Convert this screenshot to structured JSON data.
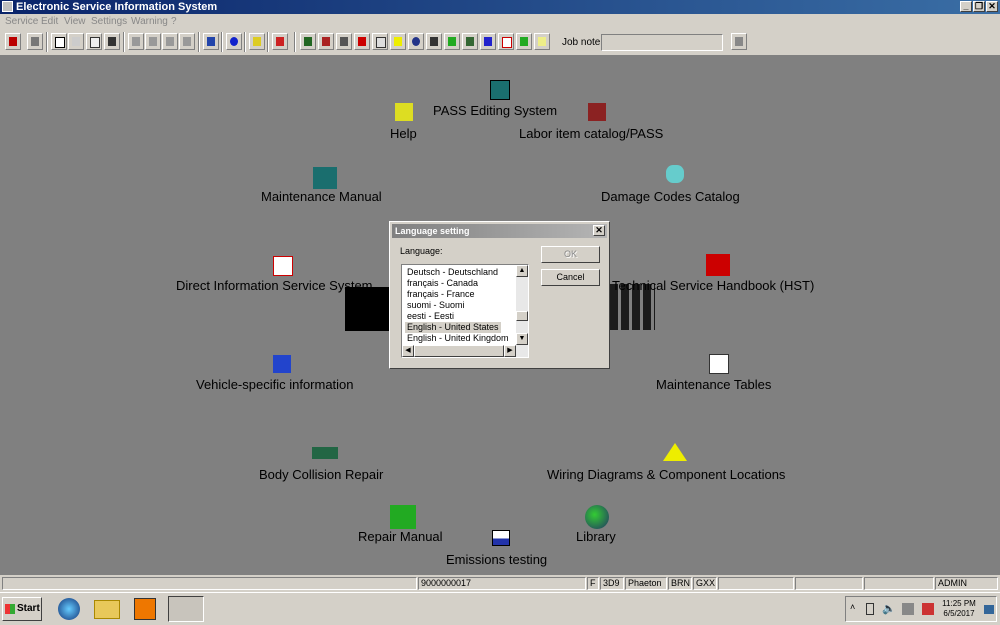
{
  "window": {
    "title": "Electronic Service Information System"
  },
  "menu": [
    "Service",
    "Edit",
    "View",
    "Settings",
    "Warning",
    "?"
  ],
  "toolbar": {
    "job_note_label": "Job note:",
    "job_note_value": ""
  },
  "main_items": [
    {
      "label": "PASS Editing System",
      "icon": "pass-icon"
    },
    {
      "label": "Help",
      "icon": "help-icon"
    },
    {
      "label": "Labor item catalog/PASS",
      "icon": "labor-catalog-icon"
    },
    {
      "label": "Maintenance Manual",
      "icon": "maintenance-manual-icon"
    },
    {
      "label": "Damage Codes Catalog",
      "icon": "damage-codes-icon"
    },
    {
      "label": "Direct Information Service System",
      "icon": "clipboard-check-icon"
    },
    {
      "label": "Technical Service Handbook (HST)",
      "icon": "handbook-icon"
    },
    {
      "label": "Vehicle-specific information",
      "icon": "vehicle-info-icon"
    },
    {
      "label": "Maintenance Tables",
      "icon": "table-icon"
    },
    {
      "label": "Body Collision Repair",
      "icon": "collision-icon"
    },
    {
      "label": "Wiring Diagrams & Component Locations",
      "icon": "warning-triangle-icon"
    },
    {
      "label": "Repair Manual",
      "icon": "repair-manual-icon"
    },
    {
      "label": "Library",
      "icon": "globe-icon"
    },
    {
      "label": "Emissions testing",
      "icon": "emissions-icon"
    }
  ],
  "dialog": {
    "title": "Language setting",
    "label": "Language:",
    "ok": "OK",
    "cancel": "Cancel",
    "close": "✕",
    "languages": [
      "Deutsch - Deutschland",
      "français - Canada",
      "français - France",
      "suomi - Suomi",
      "eesti - Eesti",
      "English - United States",
      "English - United Kingdom"
    ],
    "selected": "English - United States"
  },
  "status": {
    "code": "9000000017",
    "f": "F",
    "c1": "3D9",
    "model": "Phaeton",
    "c2": "BRN",
    "c3": "GXX",
    "user": "ADMIN"
  },
  "taskbar": {
    "start": "Start",
    "time": "11:25 PM",
    "date": "6/5/2017"
  }
}
